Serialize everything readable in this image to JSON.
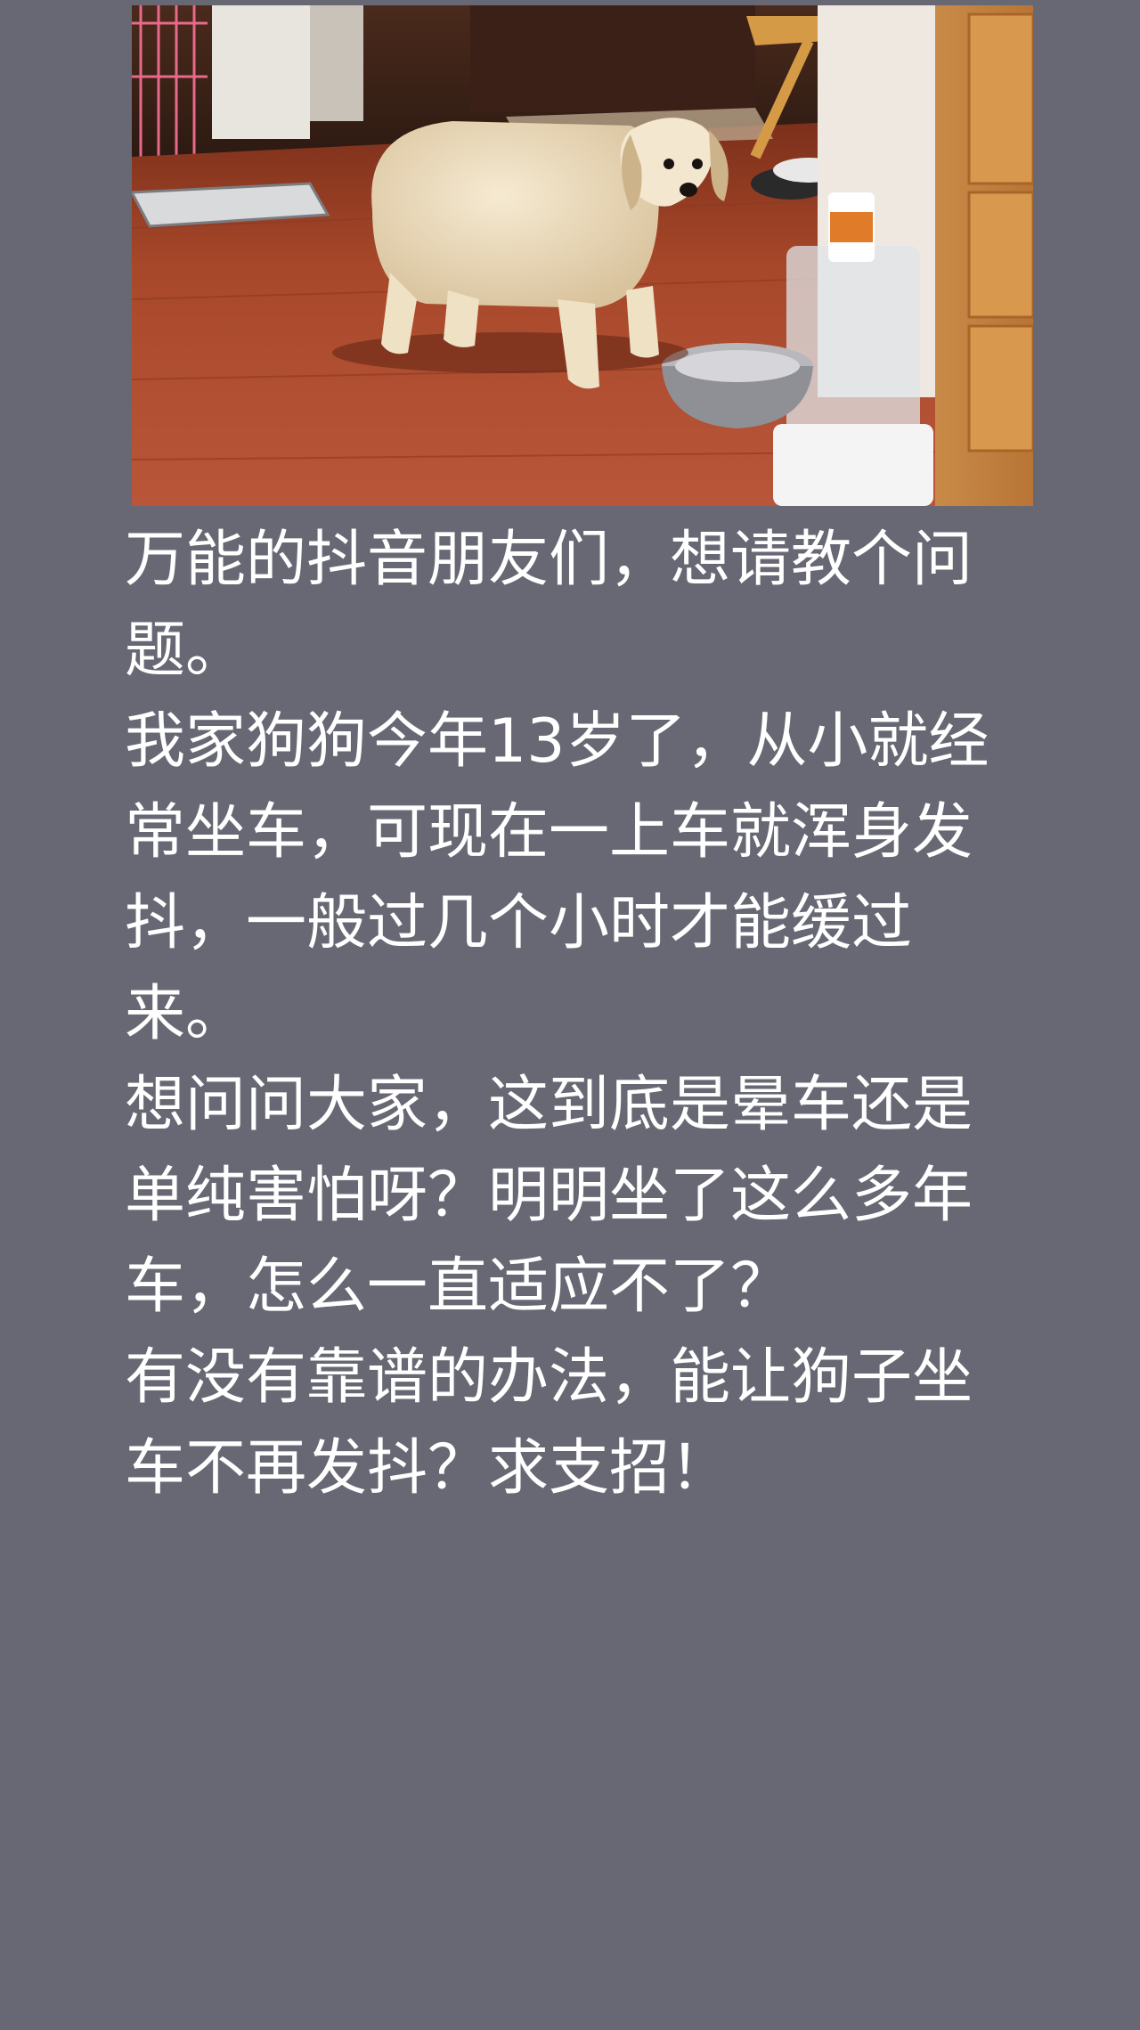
{
  "post": {
    "photo_subject": "dog-photo",
    "paragraphs": [
      "万能的抖音朋友们，想请教个问题。",
      "我家狗狗今年13岁了，从小就经常坐车，可现在一上车就浑身发抖，一般过几个小时才能缓过来。",
      "想问问大家，这到底是晕车还是单纯害怕呀？明明坐了这么多年车，怎么一直适应不了？",
      "有没有靠谱的办法，能让狗子坐车不再发抖？求支招！"
    ]
  },
  "colors": {
    "background": "#676873",
    "text": "#ffffff"
  }
}
